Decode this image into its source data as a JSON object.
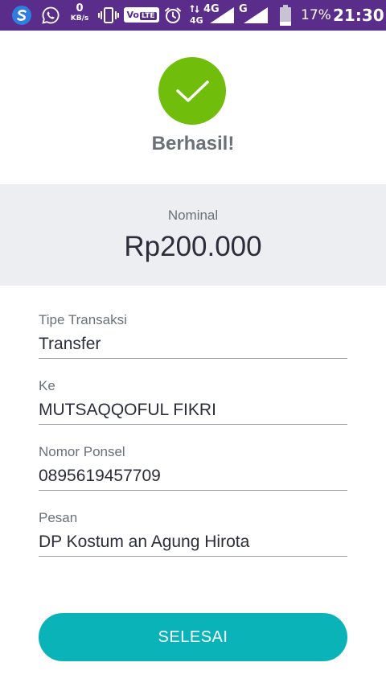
{
  "status_bar": {
    "icons": [
      "s-app-icon",
      "whatsapp-icon",
      "vibrate-icon",
      "alarm-icon",
      "signal-icon",
      "battery-icon"
    ],
    "net_speed_value": "0",
    "net_speed_unit": "KB/s",
    "volte_label": "Vo",
    "volte_lte": "LTE",
    "network_4g_small": "4G",
    "network_4g": "4G",
    "network_g": "G",
    "battery_percent": "17%",
    "time": "21:30"
  },
  "success": {
    "title": "Berhasil!",
    "color": "#71bd0b"
  },
  "amount": {
    "label": "Nominal",
    "value": "Rp200.000"
  },
  "details": [
    {
      "label": "Tipe Transaksi",
      "value": "Transfer"
    },
    {
      "label": "Ke",
      "value": "MUTSAQQOFUL FIKRI"
    },
    {
      "label": "Nomor Ponsel",
      "value": "0895619457709"
    },
    {
      "label": "Pesan",
      "value": "DP Kostum an Agung Hirota"
    }
  ],
  "done_button": {
    "label": "SELESAI",
    "color": "#0ab3b8"
  }
}
